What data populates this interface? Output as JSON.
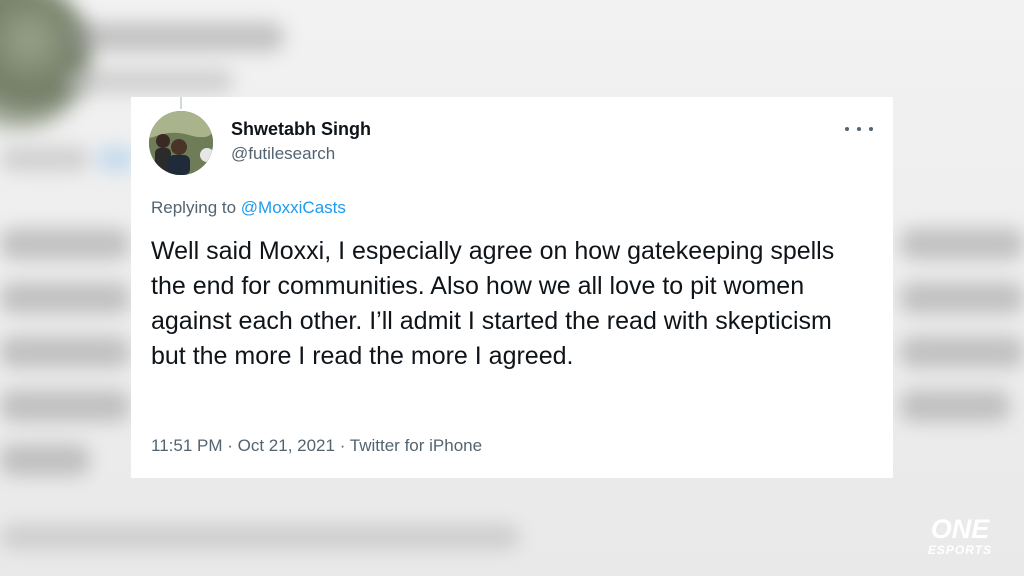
{
  "tweet": {
    "author_name": "Shwetabh Singh",
    "author_handle": "@futilesearch",
    "replying_prefix": "Replying to ",
    "replying_to": "@MoxxiCasts",
    "text": "Well said Moxxi, I especially agree on how gatekeeping spells the end for communities. Also how we all love to pit women against each other. I’ll admit I started the read with skepticism but the more I read the more I agreed.",
    "time": "11:51 PM",
    "date": "Oct 21, 2021",
    "source": "Twitter for iPhone",
    "separator": " · ",
    "more_icon": "more-horizontal-icon"
  },
  "watermark": {
    "brand_top": "ONE",
    "brand_bottom": "ESPORTS"
  },
  "colors": {
    "text_primary": "#0f1419",
    "text_secondary": "#536471",
    "link": "#1d9bf0",
    "card_bg": "#ffffff",
    "page_bg": "#eeeeee"
  }
}
